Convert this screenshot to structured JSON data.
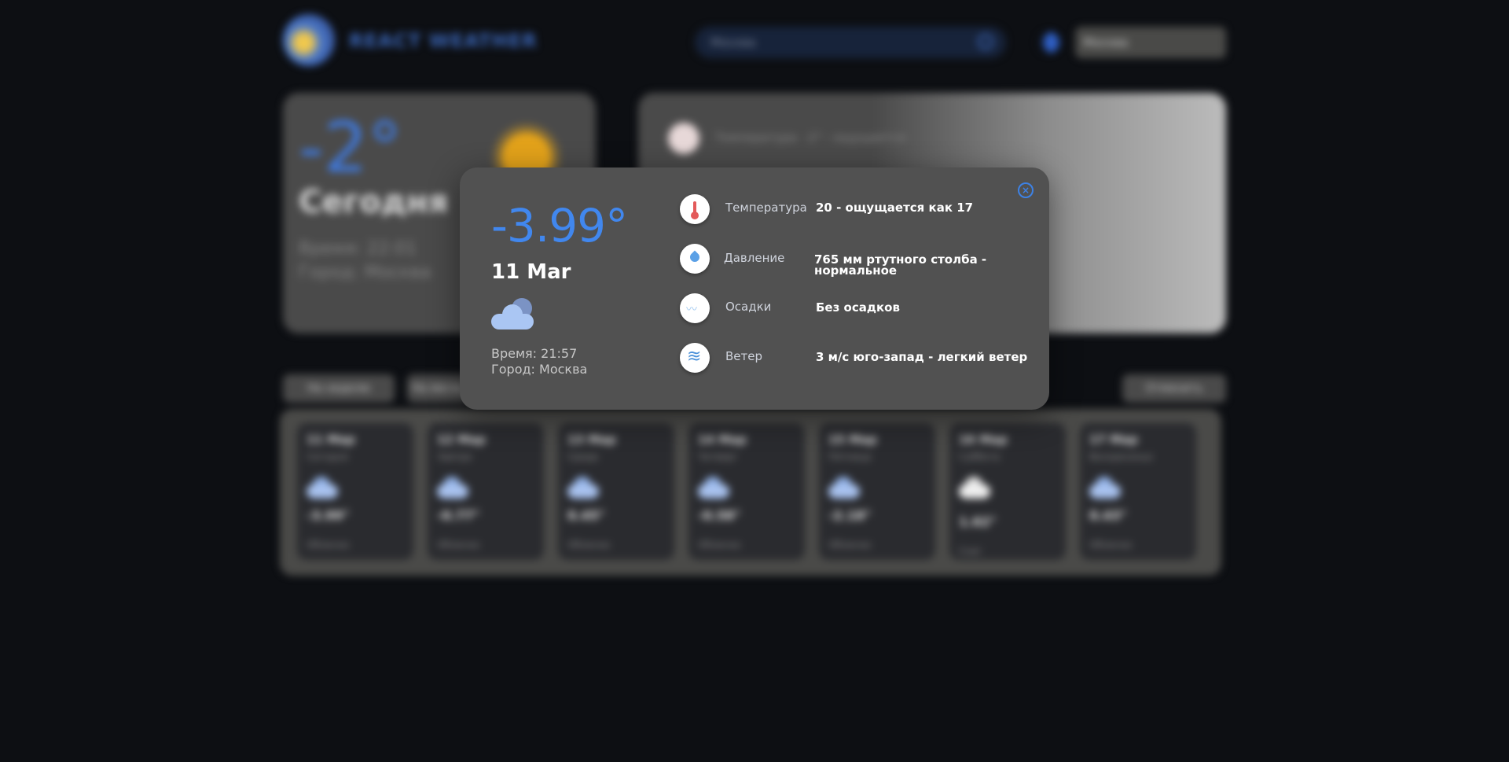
{
  "header": {
    "logo_text": "REACT WEATHER",
    "search_value": "Москва",
    "city_select": "Москва"
  },
  "today": {
    "temp": "-2°",
    "label": "Сегодня",
    "time": "Время: 22:01",
    "city": "Город: Москва",
    "info_label": "Температура",
    "info_value": "-2° - ощущается"
  },
  "tabs": {
    "week": "На неделю",
    "month": "На месяц",
    "cancel": "Отменить"
  },
  "week": [
    {
      "date": "11 Мар",
      "sub": "Сегодня",
      "temp": "-3.99°",
      "note": "Облачно",
      "icon": "cloud-icon"
    },
    {
      "date": "12 Мар",
      "sub": "Завтра",
      "temp": "-0.77°",
      "note": "Облачно",
      "icon": "cloud-icon"
    },
    {
      "date": "13 Мар",
      "sub": "Среда",
      "temp": "0.45°",
      "note": "Облачно",
      "icon": "cloud-icon"
    },
    {
      "date": "14 Мар",
      "sub": "Четверг",
      "temp": "-0.58°",
      "note": "Облачно",
      "icon": "cloud-icon"
    },
    {
      "date": "15 Мар",
      "sub": "Пятница",
      "temp": "-2.18°",
      "note": "Облачно",
      "icon": "cloud-icon"
    },
    {
      "date": "16 Мар",
      "sub": "Суббота",
      "temp": "1.62°",
      "note": "Снег",
      "icon": "snow-cloud-icon"
    },
    {
      "date": "17 Мар",
      "sub": "Воскресенье",
      "temp": "0.43°",
      "note": "Облачно",
      "icon": "cloud-icon"
    }
  ],
  "modal": {
    "temp": "-3.99°",
    "date": "11 Mar",
    "time": "Время: 21:57",
    "city": "Город: Москва",
    "rows": [
      {
        "label": "Температура",
        "value": "20 - ощущается как 17",
        "icon": "thermometer-icon"
      },
      {
        "label": "Давление",
        "value": "765 мм ртутного столба - нормальное",
        "icon": "pressure-drop-icon"
      },
      {
        "label": "Осадки",
        "value": "Без осадков",
        "icon": "precipitation-icon"
      },
      {
        "label": "Ветер",
        "value": "3 м/с юго-запад - легкий ветер",
        "icon": "wind-icon"
      }
    ]
  },
  "colors": {
    "accent": "#4187ee",
    "modal_bg": "#515151",
    "page_bg": "#0d0f13"
  }
}
